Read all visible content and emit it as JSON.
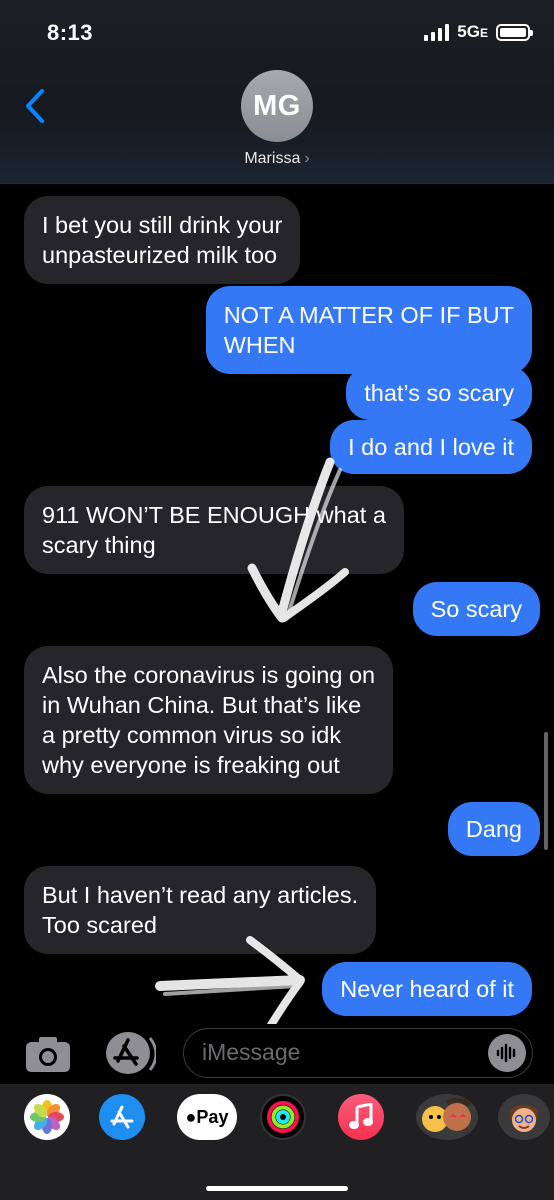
{
  "status_bar": {
    "time": "8:13",
    "network": "5G",
    "network_suffix": "E"
  },
  "header": {
    "avatar_initials": "MG",
    "contact_name": "Marissa",
    "chevron": "›"
  },
  "messages": [
    {
      "dir": "in",
      "lines": [
        "I bet you still drink your",
        "unpasteurized milk too"
      ]
    },
    {
      "dir": "out",
      "lines": [
        "NOT A MATTER OF IF BUT",
        "WHEN"
      ]
    },
    {
      "dir": "out",
      "lines": [
        "that’s so scary"
      ]
    },
    {
      "dir": "out",
      "lines": [
        "I do and I love it"
      ]
    },
    {
      "dir": "in",
      "lines": [
        "911 WON’T BE ENOUGH what a",
        "scary thing"
      ]
    },
    {
      "dir": "out",
      "lines": [
        "So scary"
      ]
    },
    {
      "dir": "in",
      "lines": [
        "Also the coronavirus is going on",
        "in Wuhan China. But that’s like",
        "a pretty common virus so idk",
        "why everyone is freaking out"
      ]
    },
    {
      "dir": "out",
      "lines": [
        "Dang"
      ]
    },
    {
      "dir": "in",
      "lines": [
        "But I haven’t read any articles.",
        "Too scared"
      ]
    },
    {
      "dir": "out",
      "lines": [
        "Never heard of it"
      ]
    }
  ],
  "compose": {
    "placeholder": "iMessage"
  },
  "app_drawer": {
    "apps": [
      {
        "name": "photos-app-icon"
      },
      {
        "name": "app-store-app-icon"
      },
      {
        "name": "apple-pay-app-icon",
        "label": "Pay"
      },
      {
        "name": "activity-app-icon"
      },
      {
        "name": "music-app-icon"
      },
      {
        "name": "animoji-app-icon"
      },
      {
        "name": "memoji-app-icon"
      }
    ]
  },
  "colors": {
    "outgoing_bubble": "#3478f6",
    "incoming_bubble": "#26252a",
    "ios_blue": "#0a84ff"
  }
}
